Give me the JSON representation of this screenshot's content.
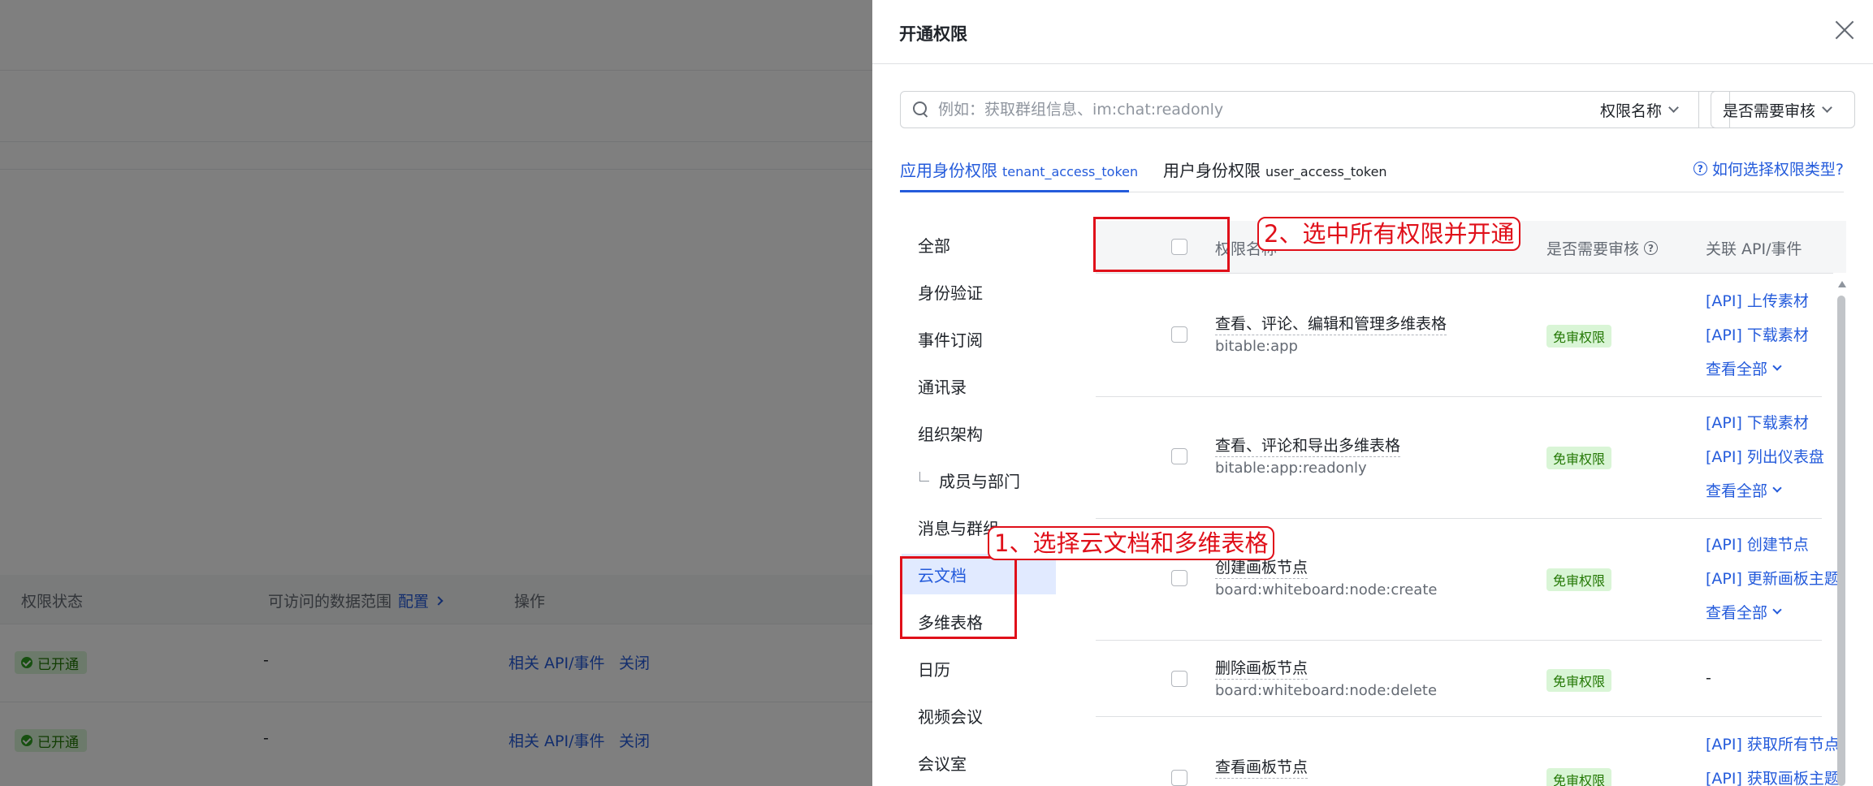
{
  "background": {
    "columns": [
      "权限状态",
      "可访问的数据范围",
      "配置",
      "操作"
    ],
    "rows": [
      {
        "status": "已开通",
        "scope": "-",
        "api_link": "相关 API/事件",
        "close_link": "关闭"
      },
      {
        "status": "已开通",
        "scope": "-",
        "api_link": "相关 API/事件",
        "close_link": "关闭"
      }
    ]
  },
  "drawer": {
    "title": "开通权限",
    "search": {
      "placeholder": "例如：获取群组信息、im:chat:readonly",
      "value": ""
    },
    "filter_scope": "权限名称",
    "filter_review": "是否需要审核",
    "tabs": [
      {
        "label": "应用身份权限",
        "sub": "tenant_access_token",
        "active": true
      },
      {
        "label": "用户身份权限",
        "sub": "user_access_token",
        "active": false
      }
    ],
    "help_link": "如何选择权限类型?",
    "categories": [
      {
        "label": "全部"
      },
      {
        "label": "身份验证"
      },
      {
        "label": "事件订阅"
      },
      {
        "label": "通讯录"
      },
      {
        "label": "组织架构"
      },
      {
        "label": "成员与部门"
      },
      {
        "label": "消息与群组"
      },
      {
        "label": "云文档",
        "active": true
      },
      {
        "label": "多维表格"
      },
      {
        "label": "日历"
      },
      {
        "label": "视频会议"
      },
      {
        "label": "会议室"
      }
    ],
    "table": {
      "headers": {
        "name": "权限名称",
        "review": "是否需要审核",
        "api": "关联 API/事件"
      },
      "rows": [
        {
          "name": "查看、评论、编辑和管理多维表格",
          "code": "bitable:app",
          "badge": "免审权限",
          "apis": [
            "[API] 上传素材",
            "[API] 下载素材"
          ],
          "view_all": "查看全部"
        },
        {
          "name": "查看、评论和导出多维表格",
          "code": "bitable:app:readonly",
          "badge": "免审权限",
          "apis": [
            "[API] 下载素材",
            "[API] 列出仪表盘"
          ],
          "view_all": "查看全部"
        },
        {
          "name": "创建画板节点",
          "code": "board:whiteboard:node:create",
          "badge": "免审权限",
          "apis": [
            "[API] 创建节点",
            "[API] 更新画板主题"
          ],
          "view_all": "查看全部"
        },
        {
          "name": "删除画板节点",
          "code": "board:whiteboard:node:delete",
          "badge": "免审权限",
          "apis": [
            "-"
          ],
          "view_all": ""
        },
        {
          "name": "查看画板节点",
          "code": "",
          "badge": "免审权限",
          "apis": [
            "[API] 获取所有节点",
            "[API] 获取画板主题"
          ],
          "view_all": ""
        }
      ]
    }
  },
  "annotations": {
    "step1": "1、选择云文档和多维表格",
    "step2": "2、选中所有权限并开通"
  },
  "colors": {
    "accent": "#245bdb",
    "annotation": "#e0101a",
    "badge_bg": "#d9f5d6",
    "badge_text": "#237804"
  }
}
